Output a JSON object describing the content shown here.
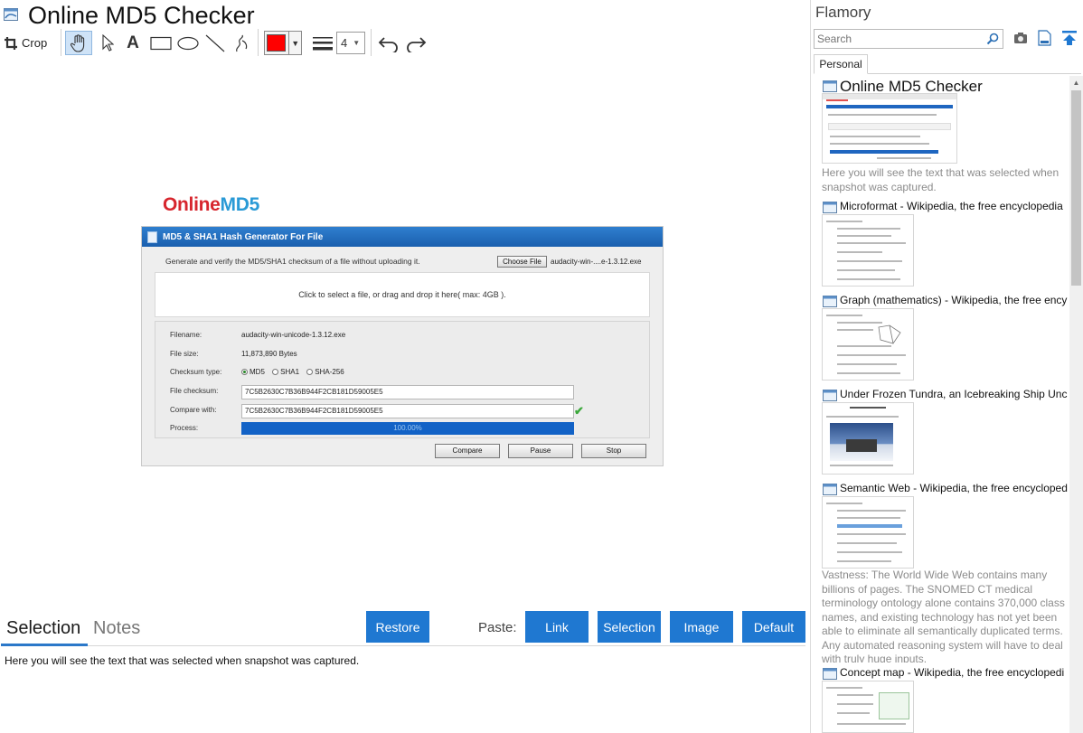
{
  "window": {
    "title": "Online MD5 Checker"
  },
  "toolbar": {
    "crop_label": "Crop",
    "line_width": "4",
    "pen_color": "#ff0000"
  },
  "snapshot": {
    "logo_part1": "Online",
    "logo_part2": "MD5",
    "panel_title": "MD5 & SHA1 Hash Generator For File",
    "intro": "Generate and verify the MD5/SHA1 checksum of a file without uploading it.",
    "choose_file_label": "Choose File",
    "chosen_file": "audacity-win-....e-1.3.12.exe",
    "drop_text": "Click to select a file, or drag and drop it here( max: 4GB ).",
    "filename_label": "Filename:",
    "filename_value": "audacity-win-unicode-1.3.12.exe",
    "filesize_label": "File size:",
    "filesize_value": "11,873,890 Bytes",
    "checksum_type_label": "Checksum type:",
    "checksum_types": [
      "MD5",
      "SHA1",
      "SHA-256"
    ],
    "file_checksum_label": "File checksum:",
    "file_checksum_value": "7C5B2630C7B36B944F2CB181D59005E5",
    "compare_with_label": "Compare with:",
    "compare_with_value": "7C5B2630C7B36B944F2CB181D59005E5",
    "process_label": "Process:",
    "process_value": "100.00%",
    "compare_label": "Compare",
    "pause_label": "Pause",
    "stop_label": "Stop"
  },
  "bottom": {
    "tab_selection": "Selection",
    "tab_notes": "Notes",
    "restore_label": "Restore",
    "paste_label": "Paste:",
    "link_label": "Link",
    "selection_label": "Selection",
    "image_label": "Image",
    "default_label": "Default",
    "selection_text": "Here you will see the text that was selected when snapshot was captured."
  },
  "sidebar": {
    "brand": "Flamory",
    "search_placeholder": "Search",
    "tab_personal": "Personal",
    "items": [
      {
        "title": "Online MD5 Checker",
        "snippet": "Here you will see the text that was selected when snapshot was captured."
      },
      {
        "title": "Microformat - Wikipedia, the free encyclopedia"
      },
      {
        "title": "Graph (mathematics) - Wikipedia, the free ency"
      },
      {
        "title": "Under Frozen Tundra, an Icebreaking Ship Unco"
      },
      {
        "title": "Semantic Web - Wikipedia, the free encycloped",
        "snippet": "Vastness: The World Wide Web contains many billions of pages. The SNOMED CT medical terminology ontology alone contains 370,000 class names, and existing technology has not yet been able to eliminate all semantically duplicated terms. Any automated reasoning system will have to deal with truly huge inputs."
      },
      {
        "title": "Concept map - Wikipedia, the free encyclopedi"
      }
    ]
  },
  "colors": {
    "accent": "#1f78d1",
    "progress": "#1262c6",
    "brand_red": "#d7262e",
    "brand_blue": "#2a9ad6"
  },
  "icons": [
    "window-icon",
    "crop-icon",
    "hand-icon",
    "arrow-icon",
    "text-icon",
    "rectangle-icon",
    "ellipse-icon",
    "line-icon",
    "pen-icon",
    "line-width-icon",
    "undo-icon",
    "redo-icon",
    "search-icon",
    "camera-icon",
    "page-icon",
    "upload-icon"
  ]
}
